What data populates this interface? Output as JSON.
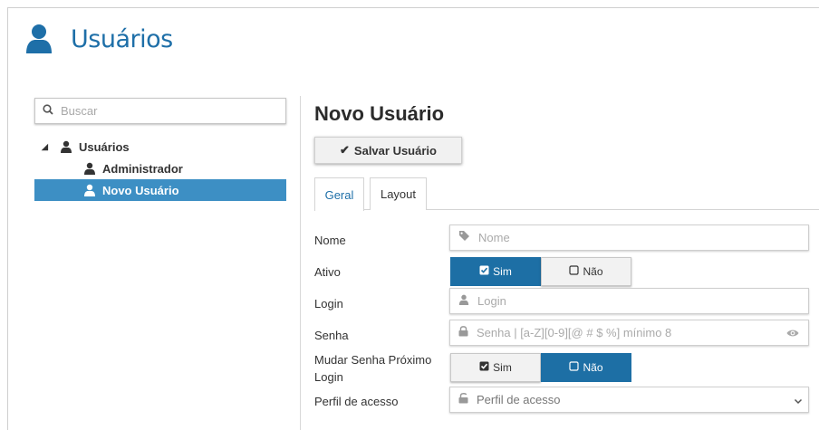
{
  "header": {
    "title": "Usuários",
    "icon": "user-icon",
    "color": "#1e6fa8"
  },
  "sidebar": {
    "search_placeholder": "Buscar",
    "tree": {
      "root_label": "Usuários",
      "children": [
        {
          "label": "Administrador",
          "selected": false
        },
        {
          "label": "Novo Usuário",
          "selected": true
        }
      ]
    },
    "selected_color": "#3d8fc4"
  },
  "main": {
    "title": "Novo Usuário",
    "save_label": "Salvar Usuário",
    "tabs": [
      {
        "label": "Geral",
        "active": true
      },
      {
        "label": "Layout",
        "active": false
      }
    ],
    "form": {
      "nome": {
        "label": "Nome",
        "placeholder": "Nome",
        "icon": "tag-icon"
      },
      "ativo": {
        "label": "Ativo",
        "options": [
          "Sim",
          "Não"
        ],
        "selected": "Sim"
      },
      "login": {
        "label": "Login",
        "placeholder": "Login",
        "icon": "user-icon"
      },
      "senha": {
        "label": "Senha",
        "placeholder": "Senha | [a-Z][0-9][@ # $ %] mínimo 8",
        "icon": "lock-icon",
        "trailing_icon": "eye-icon"
      },
      "mudar_senha": {
        "label": "Mudar Senha Próximo Login",
        "options": [
          "Sim",
          "Não"
        ],
        "selected": "Não"
      },
      "perfil": {
        "label": "Perfil de acesso",
        "value": "Perfil de acesso",
        "icon": "unlock-icon"
      }
    },
    "accent_color": "#1d6fa5"
  }
}
